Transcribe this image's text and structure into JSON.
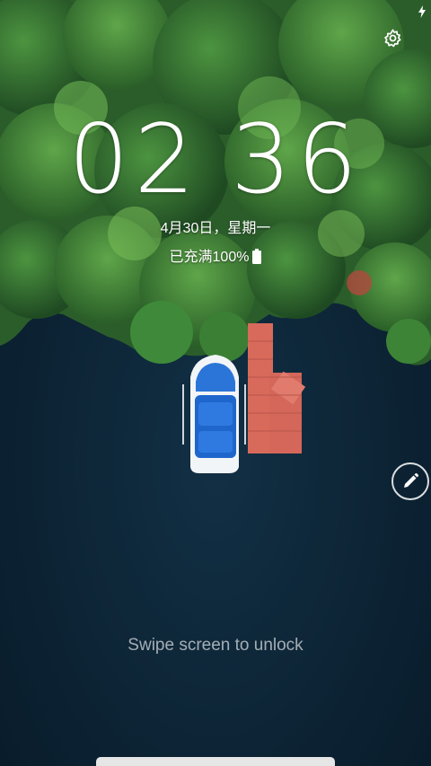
{
  "status": {
    "charging_icon": "lightning-bolt-icon"
  },
  "settings": {
    "icon": "gear-icon"
  },
  "clock": {
    "hours": "02",
    "minutes": "36"
  },
  "date": {
    "text": "4月30日，星期一"
  },
  "battery": {
    "text": "已充满100%",
    "icon": "battery-full-icon",
    "level_percent": 100
  },
  "edit": {
    "icon": "pencil-icon"
  },
  "unlock": {
    "hint": "Swipe screen to unlock"
  },
  "colors": {
    "water": "#0c2233",
    "foliage": "#2c6a2c",
    "dock": "#d96a5c",
    "boat_seat": "#1f6ad4"
  }
}
